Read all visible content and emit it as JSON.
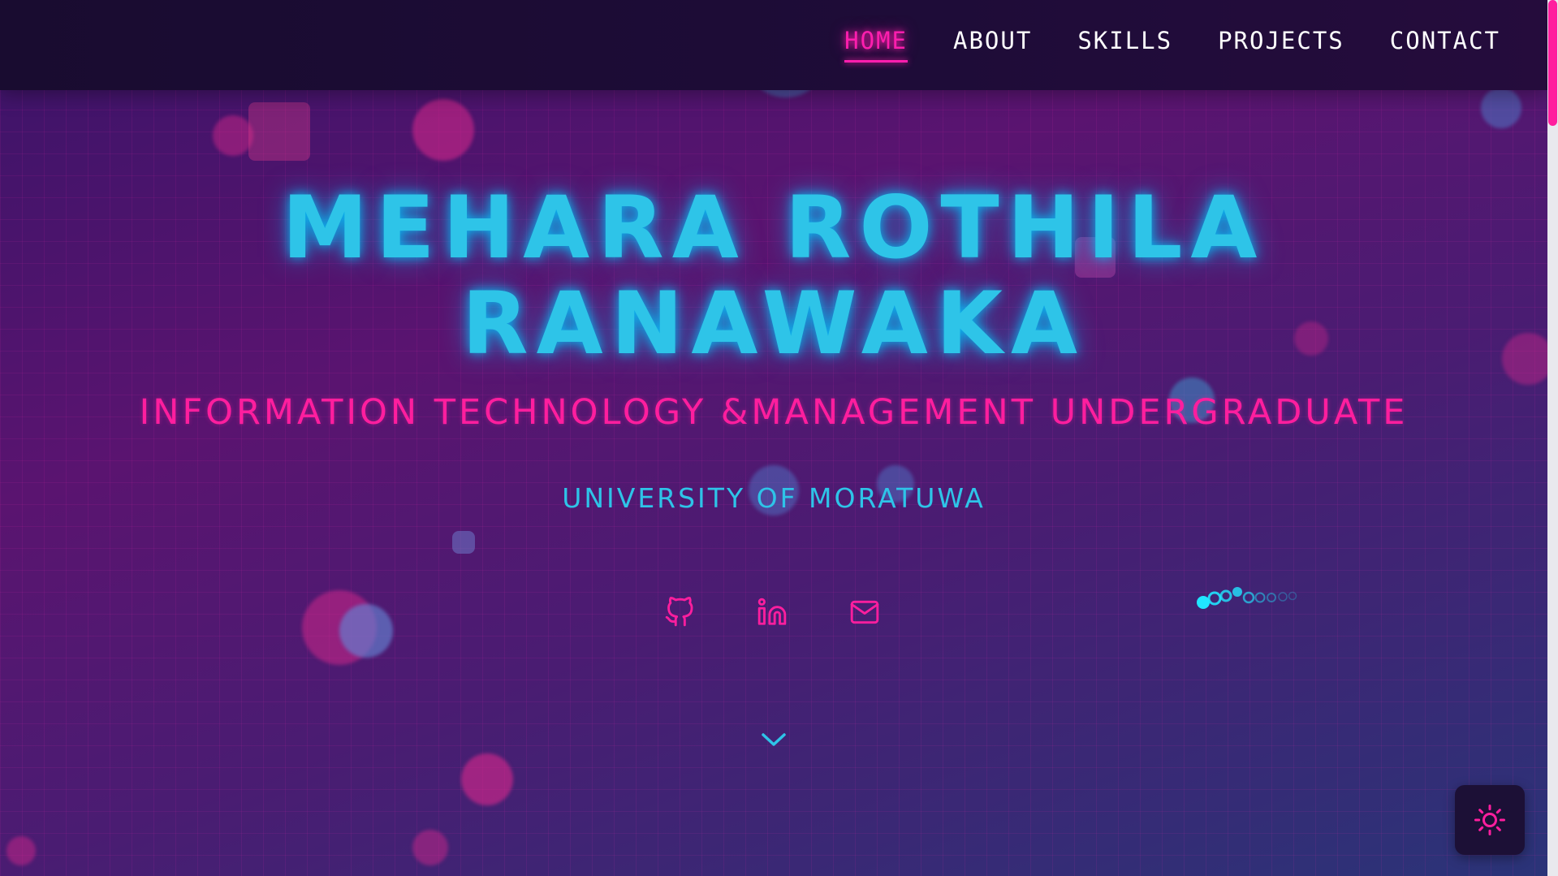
{
  "nav": {
    "items": [
      {
        "label": "HOME",
        "active": true
      },
      {
        "label": "ABOUT",
        "active": false
      },
      {
        "label": "SKILLS",
        "active": false
      },
      {
        "label": "PROJECTS",
        "active": false
      },
      {
        "label": "CONTACT",
        "active": false
      }
    ]
  },
  "hero": {
    "name_line1": "MEHARA ROTHILA",
    "name_line2": "RANAWAKA",
    "subtitle": "INFORMATION TECHNOLOGY &MANAGEMENT UNDERGRADUATE",
    "university": "UNIVERSITY OF MORATUWA"
  },
  "socials": [
    {
      "icon": "github-icon"
    },
    {
      "icon": "linkedin-icon"
    },
    {
      "icon": "mail-icon"
    }
  ],
  "theme_toggle": {
    "icon": "sun-icon"
  },
  "colors": {
    "accent_pink": "#ff1e9e",
    "accent_cyan": "#2ec4e8",
    "header_bg": "#190c30"
  }
}
